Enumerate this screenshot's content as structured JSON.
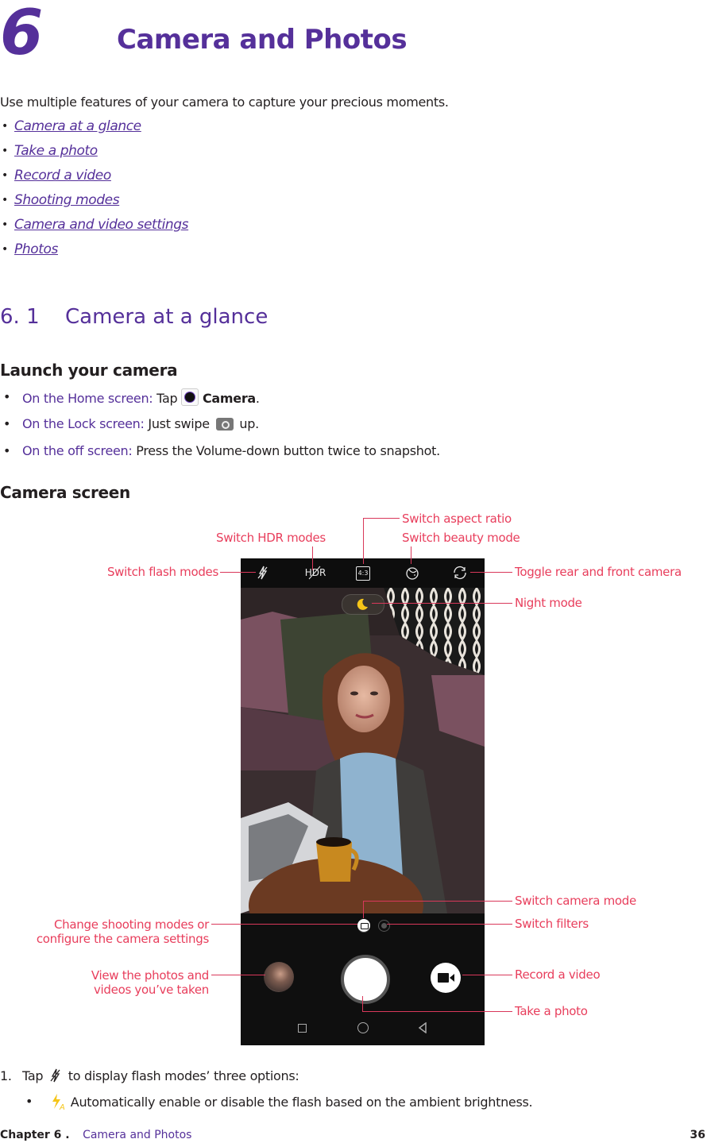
{
  "chapter": {
    "number": "6",
    "title": "Camera and Photos",
    "intro": "Use multiple features of your camera to capture your precious moments.",
    "toc": [
      "Camera at a glance",
      "Take a photo",
      "Record a video",
      "Shooting modes",
      "Camera and video settings",
      "Photos"
    ]
  },
  "section": {
    "number": "6. 1",
    "title": "Camera at a glance"
  },
  "launch": {
    "heading": "Launch your camera",
    "items": [
      {
        "lead": "On the Home screen:",
        "pre": " Tap ",
        "icon": "camera-app-icon",
        "bold": "Camera",
        "post": "."
      },
      {
        "lead": "On the Lock screen:",
        "pre": " Just swipe ",
        "icon": "camera-shortcut-icon",
        "post": " up."
      },
      {
        "lead": "On the off screen:",
        "pre": " Press the Volume-down button twice to snapshot."
      }
    ]
  },
  "camera_screen": {
    "heading": "Camera screen",
    "topbar": {
      "hdr_label": "HDR",
      "ratio_label": "4:3"
    },
    "callouts": {
      "flash": "Switch flash modes",
      "hdr": "Switch HDR modes",
      "aspect": "Switch aspect ratio",
      "beauty": "Switch beauty mode",
      "toggle": "Toggle rear and front camera",
      "night": "Night mode",
      "camera_mode": "Switch camera mode",
      "filters": "Switch filters",
      "shooting_line1": "Change shooting modes or",
      "shooting_line2": "configure the camera settings",
      "gallery_line1": "View the photos and",
      "gallery_line2": "videos you’ve taken",
      "record": "Record a video",
      "take": "Take a photo"
    }
  },
  "steps": {
    "step1_num": "1.",
    "step1_pre": "Tap",
    "step1_post": "to display flash modes’ three options:",
    "auto_flash_text": "Automatically enable or disable the flash based on the ambient brightness."
  },
  "footer": {
    "chapter_label": "Chapter 6 .",
    "chapter_title": "Camera and Photos",
    "page_number": "36"
  },
  "colors": {
    "accent_purple": "#55309a",
    "callout_red": "#e83e5c",
    "flash_yellow": "#f5c518"
  }
}
